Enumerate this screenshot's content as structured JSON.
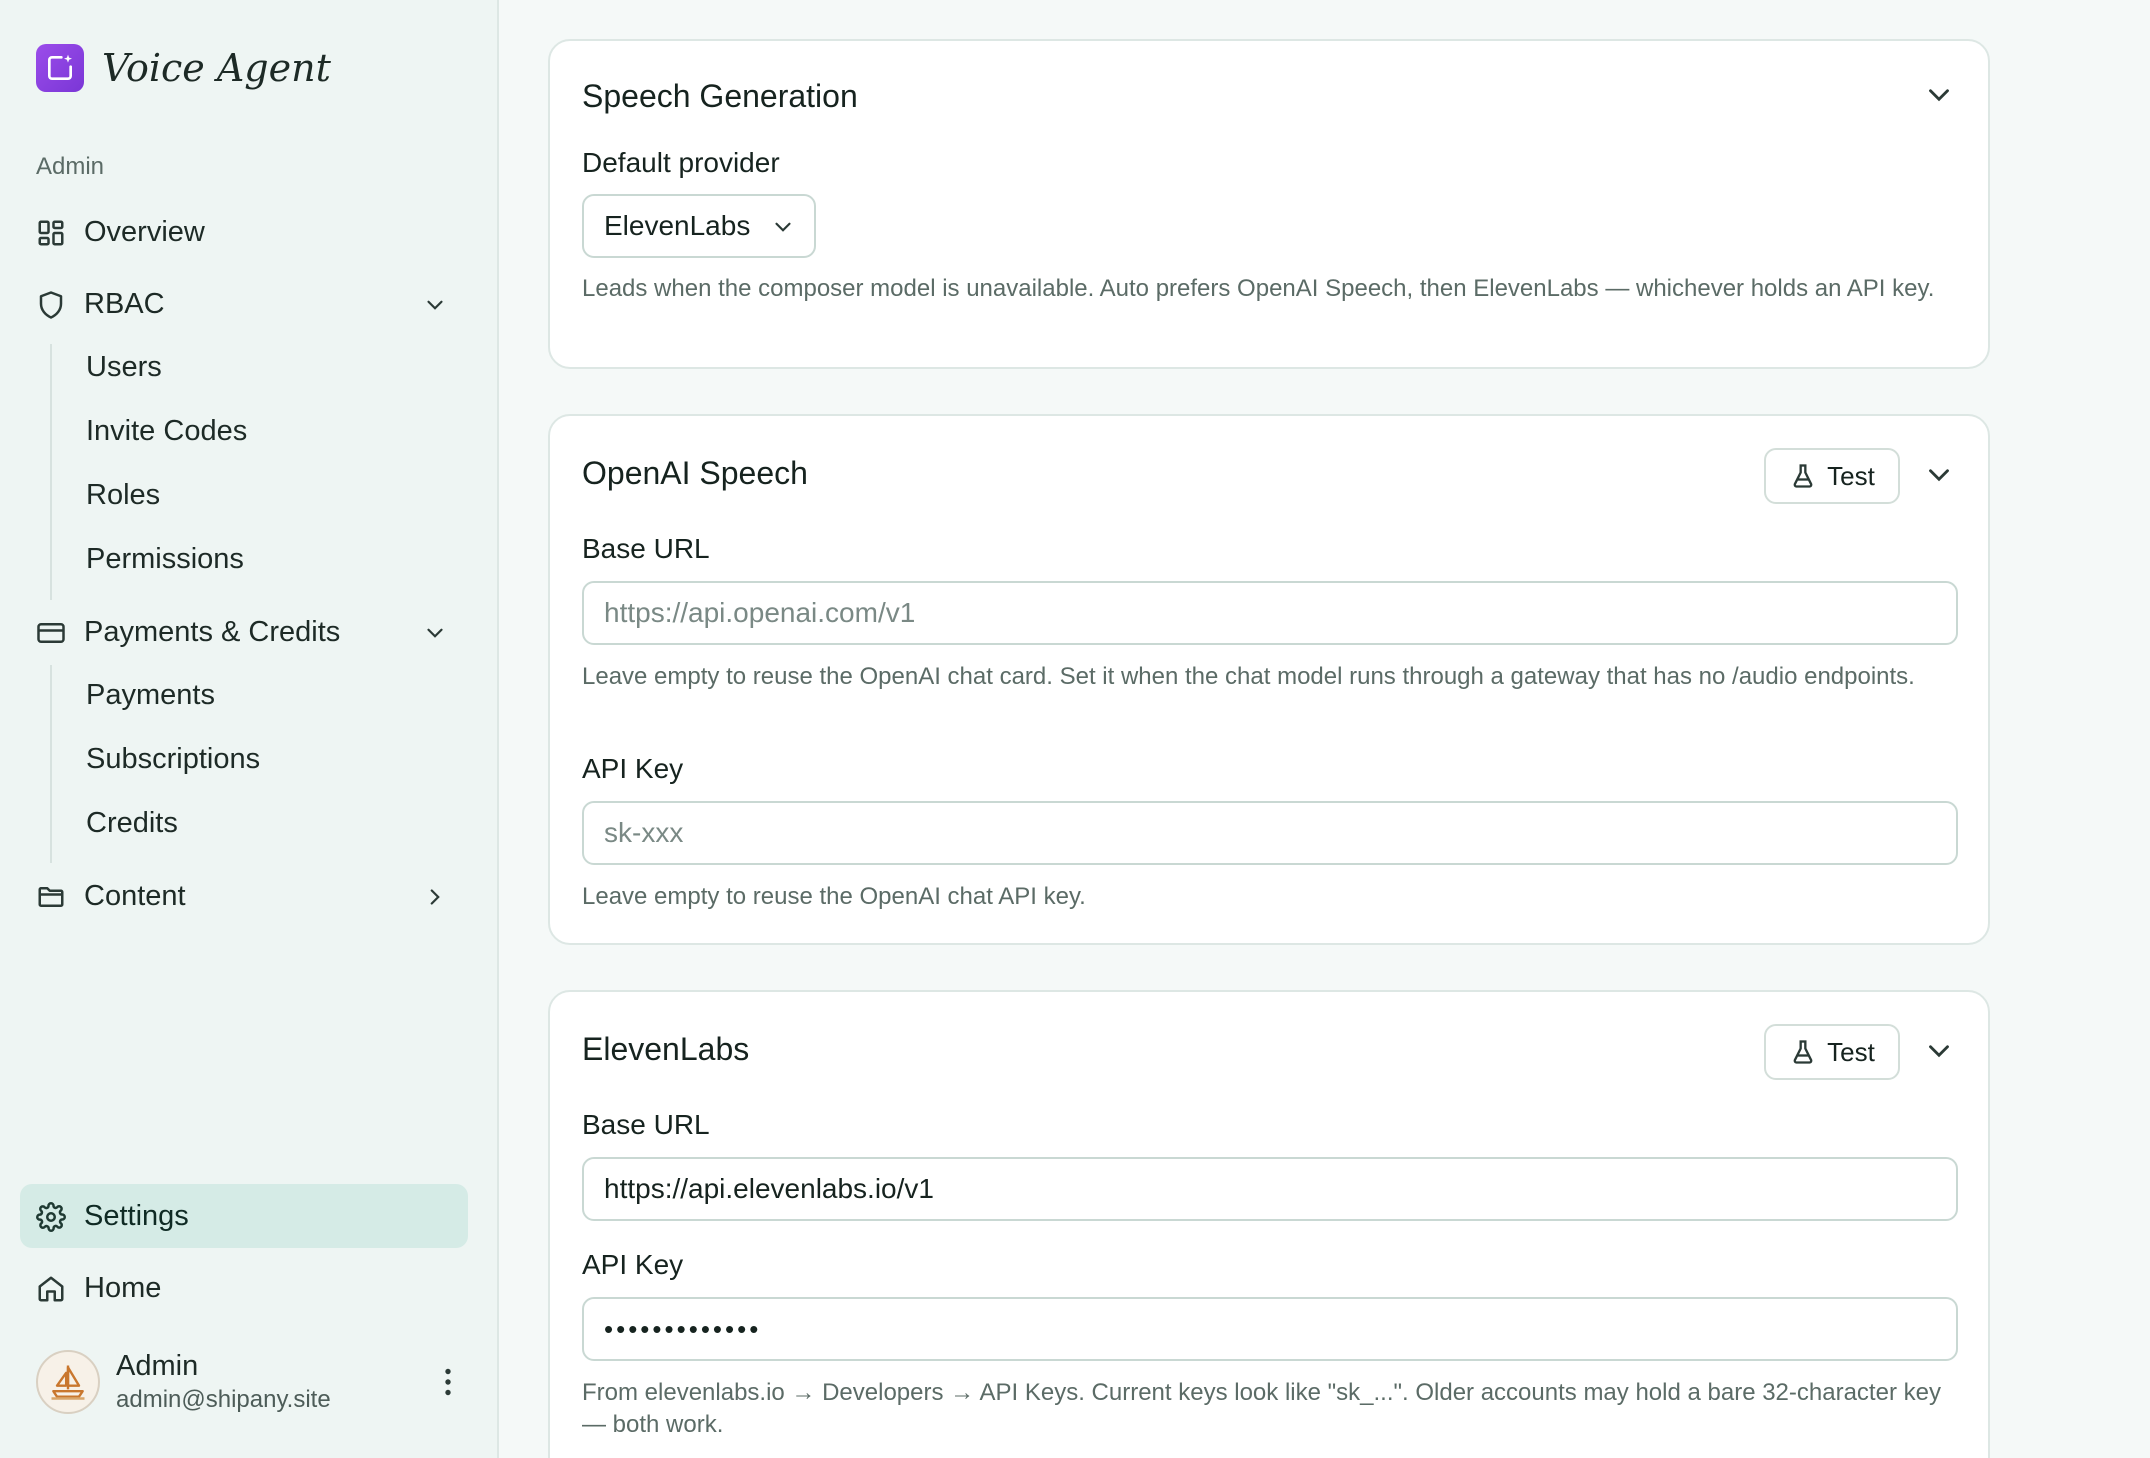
{
  "app": {
    "name": "Voice Agent"
  },
  "sidebar": {
    "section_label": "Admin",
    "overview": "Overview",
    "rbac": {
      "label": "RBAC",
      "items": [
        "Users",
        "Invite Codes",
        "Roles",
        "Permissions"
      ]
    },
    "payments": {
      "label": "Payments & Credits",
      "items": [
        "Payments",
        "Subscriptions",
        "Credits"
      ]
    },
    "content": "Content",
    "settings": "Settings",
    "home": "Home"
  },
  "user": {
    "name": "Admin",
    "email": "admin@shipany.site"
  },
  "speech_generation": {
    "title": "Speech Generation",
    "default_provider_label": "Default provider",
    "default_provider_value": "ElevenLabs",
    "help": "Leads when the composer model is unavailable. Auto prefers OpenAI Speech, then ElevenLabs — whichever holds an API key."
  },
  "openai_speech": {
    "title": "OpenAI Speech",
    "test_label": "Test",
    "base_url_label": "Base URL",
    "base_url_placeholder": "https://api.openai.com/v1",
    "base_url_help": "Leave empty to reuse the OpenAI chat card. Set it when the chat model runs through a gateway that has no /audio endpoints.",
    "api_key_label": "API Key",
    "api_key_placeholder": "sk-xxx",
    "api_key_help": "Leave empty to reuse the OpenAI chat API key."
  },
  "elevenlabs": {
    "title": "ElevenLabs",
    "test_label": "Test",
    "base_url_label": "Base URL",
    "base_url_value": "https://api.elevenlabs.io/v1",
    "api_key_label": "API Key",
    "api_key_value": "•••••••••••••",
    "api_key_help": "From elevenlabs.io → Developers → API Keys. Current keys look like \"sk_...\". Older accounts may hold a bare 32-character key — both work."
  },
  "colors": {
    "accent": "#8b44e3",
    "active_nav": "#d5ebe6",
    "sidebar_bg": "#eef5f3"
  }
}
